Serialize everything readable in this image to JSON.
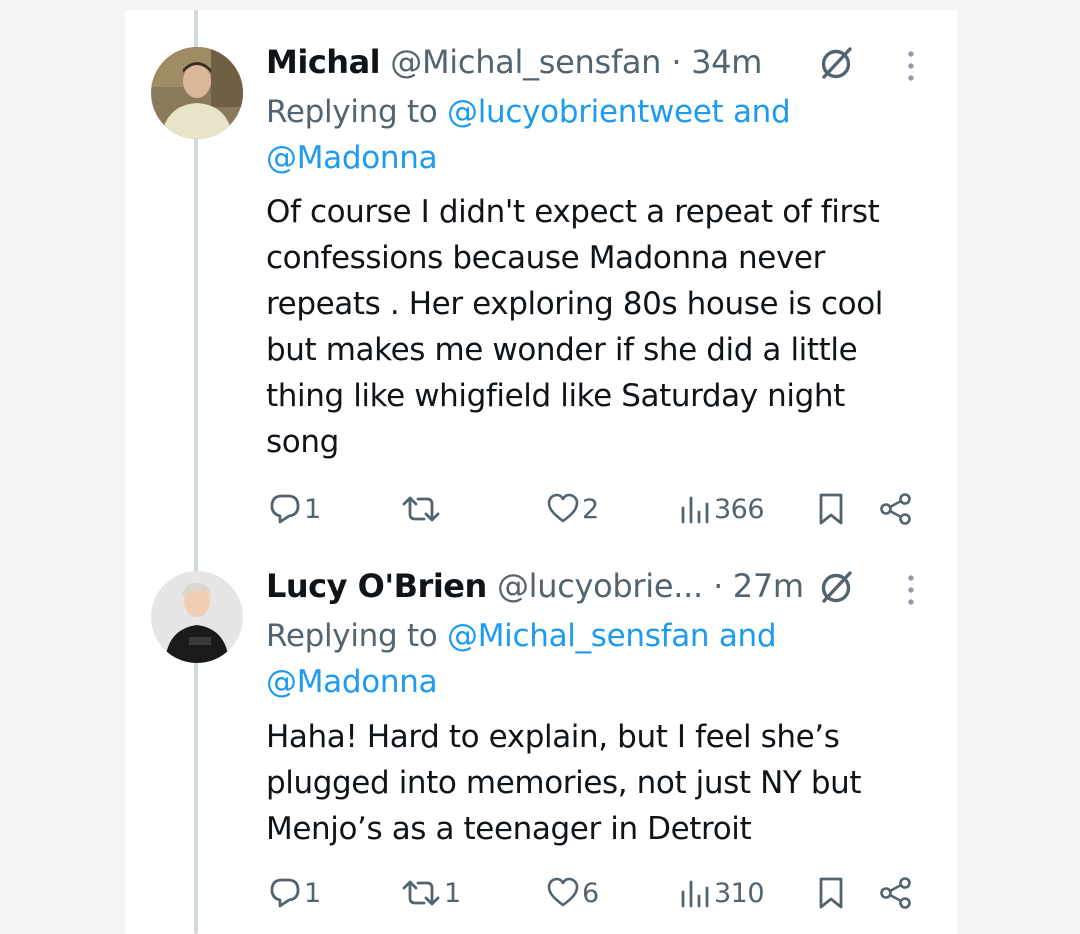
{
  "tweets": [
    {
      "name": "Michal",
      "handle": "@Michal_sensfan",
      "time": "· 34m",
      "replying_prefix": "Replying to",
      "replying_mention1": "@lucyobrientweet",
      "replying_and": "and",
      "replying_mention2": "@Madonna",
      "body_lines": [
        "Of course I didn't expect a repeat of first",
        "confessions because Madonna never",
        "repeats . Her exploring 80s house is cool",
        "but makes me wonder if she did a little",
        "thing like whigfield like Saturday night",
        "song"
      ],
      "replies": "1",
      "reposts": "",
      "likes": "2",
      "views": "366",
      "icons": [
        "reply-icon",
        "repost-icon",
        "like-icon",
        "views-icon",
        "bookmark-icon",
        "share-icon",
        "grok-icon",
        "more-icon"
      ]
    },
    {
      "name": "Lucy O'Brien",
      "handle": "@lucyobrie...",
      "time": "· 27m",
      "replying_prefix": "Replying to",
      "replying_mention1": "@Michal_sensfan",
      "replying_and": "and",
      "replying_mention2": "@Madonna",
      "body_lines": [
        "Haha! Hard to explain, but I feel she’s",
        "plugged into memories, not just NY but",
        "Menjo’s as a teenager in Detroit"
      ],
      "replies": "1",
      "reposts": "1",
      "likes": "6",
      "views": "310",
      "icons": [
        "reply-icon",
        "repost-icon",
        "like-icon",
        "views-icon",
        "bookmark-icon",
        "share-icon",
        "grok-icon",
        "more-icon"
      ]
    }
  ],
  "colors": {
    "text": "#0f1419",
    "muted": "#536471",
    "link": "#1d9bf0",
    "thread": "#cfd9de"
  }
}
